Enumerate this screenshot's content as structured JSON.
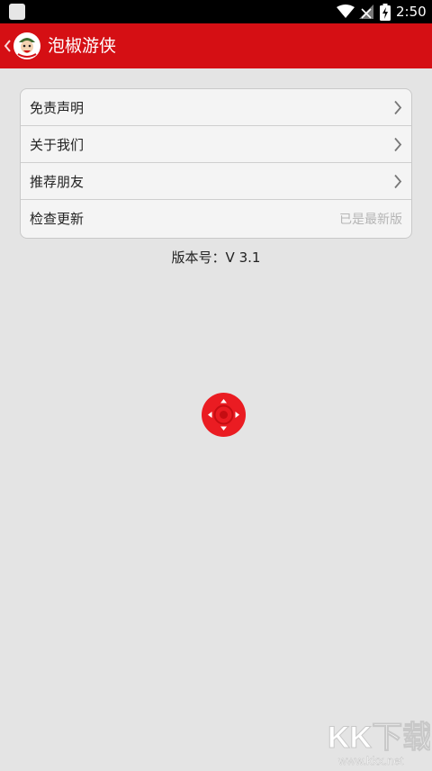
{
  "status_bar": {
    "time": "2:50"
  },
  "app_bar": {
    "title": "泡椒游侠"
  },
  "menu": {
    "items": [
      {
        "label": "免责声明"
      },
      {
        "label": "关于我们"
      },
      {
        "label": "推荐朋友"
      },
      {
        "label": "检查更新",
        "value": "已是最新版"
      }
    ]
  },
  "version_text": "版本号：V 3.1",
  "watermark": {
    "brand": "KK下载",
    "url": "www.kkx.net"
  },
  "colors": {
    "accent": "#d50f14",
    "background": "#e4e4e4",
    "float_button": "#ea1c22"
  }
}
